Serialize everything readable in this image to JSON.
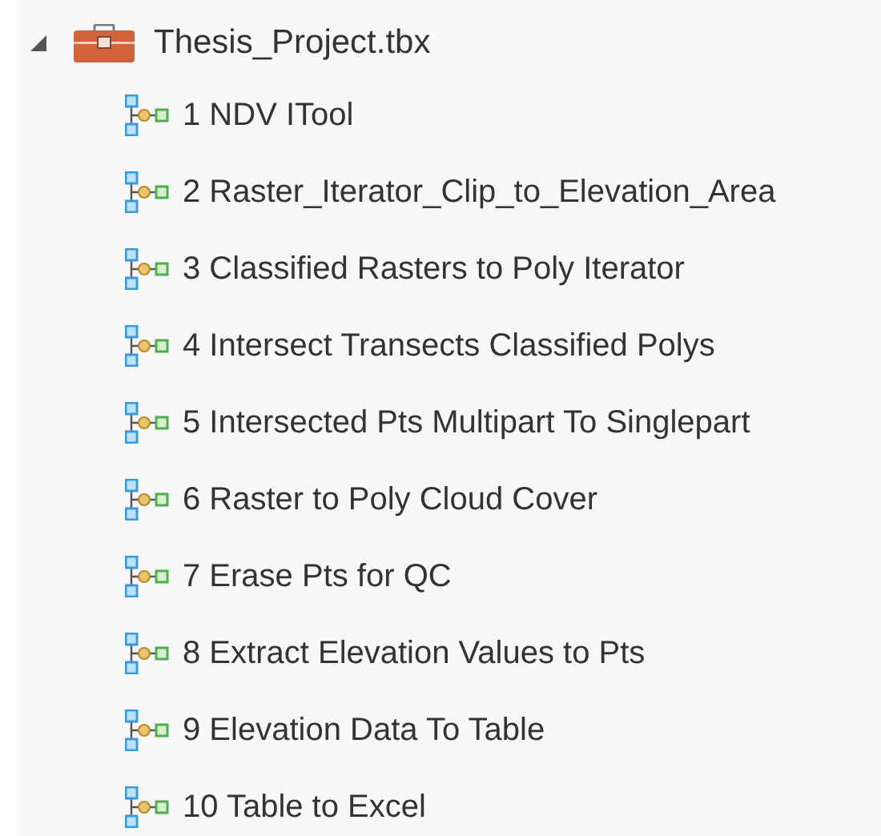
{
  "toolbox": {
    "label": "Thesis_Project.tbx",
    "expanded": true,
    "children": [
      {
        "label": "1 NDV ITool"
      },
      {
        "label": "2 Raster_Iterator_Clip_to_Elevation_Area"
      },
      {
        "label": "3 Classified Rasters to Poly Iterator"
      },
      {
        "label": "4 Intersect Transects Classified Polys"
      },
      {
        "label": "5 Intersected Pts Multipart To Singlepart"
      },
      {
        "label": "6 Raster to Poly Cloud Cover"
      },
      {
        "label": "7 Erase Pts for QC"
      },
      {
        "label": "8 Extract Elevation Values to Pts"
      },
      {
        "label": "9 Elevation Data To Table"
      },
      {
        "label": "10 Table to Excel"
      }
    ]
  }
}
